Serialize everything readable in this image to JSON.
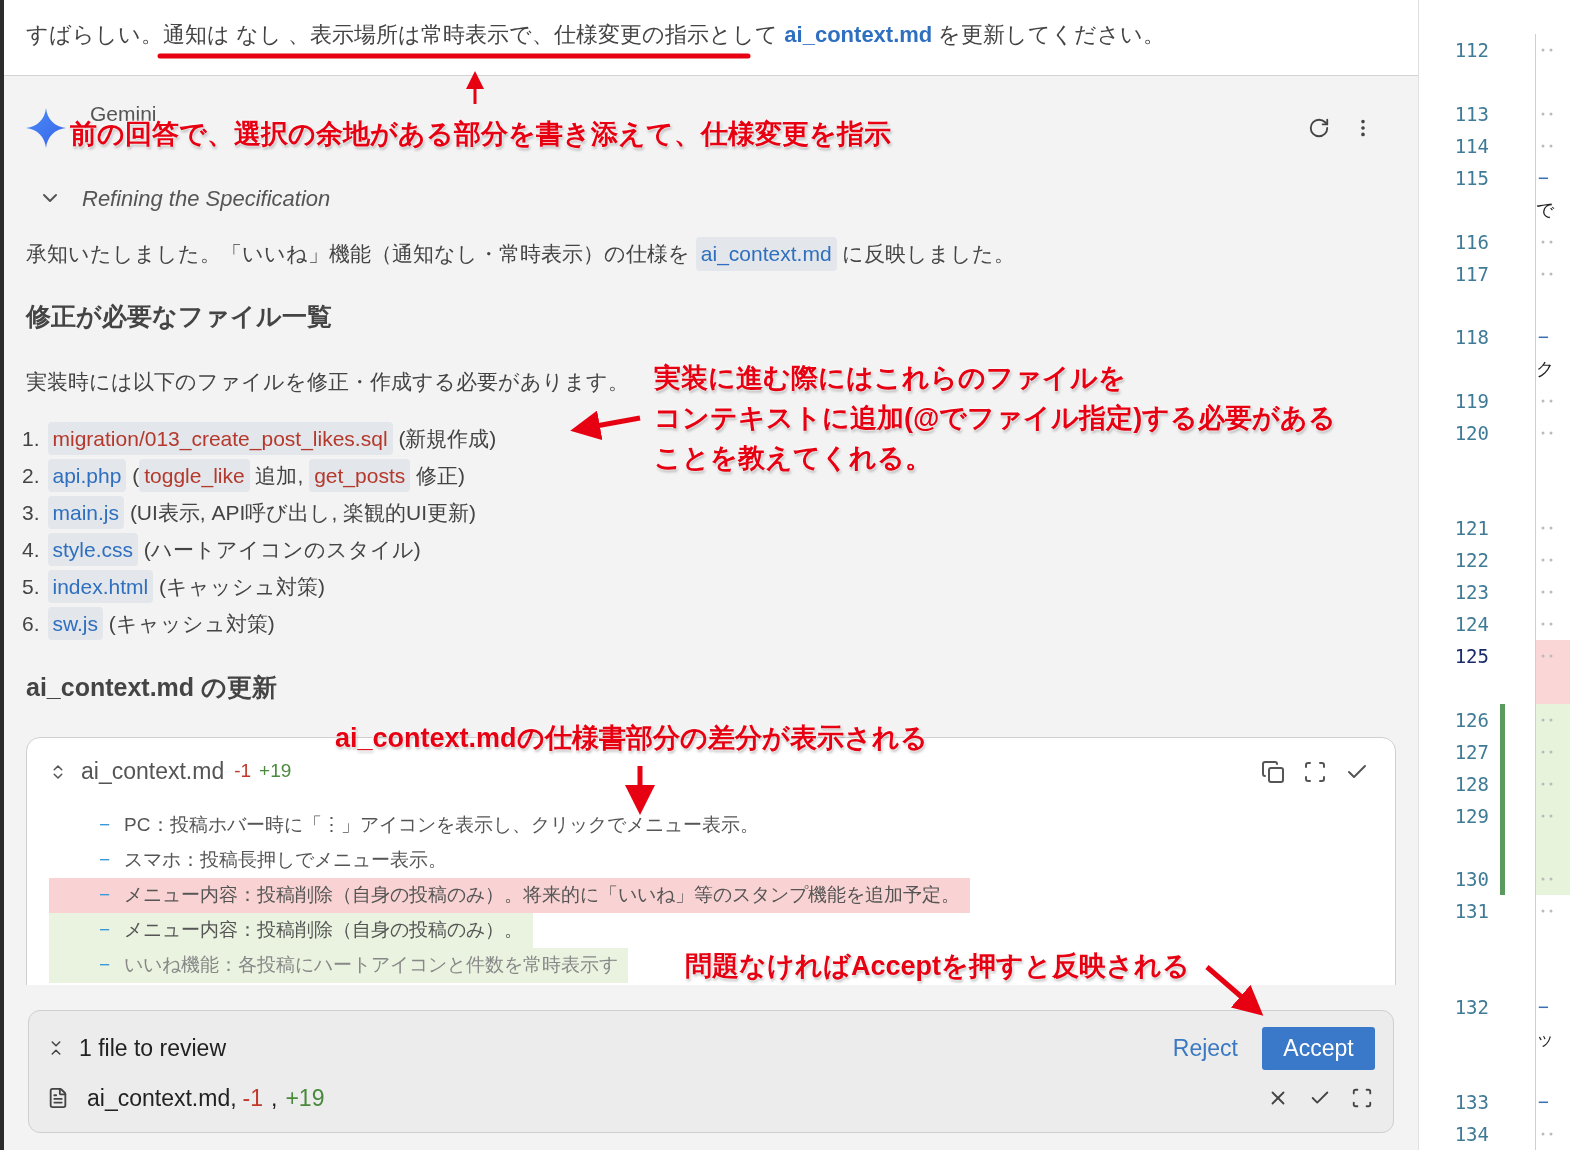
{
  "prompt": {
    "text": "すばらしい。通知は なし 、表示場所は常時表示で、仕様変更の指示として",
    "file": "ai_context.md",
    "after": "を更新してください。"
  },
  "assistant": {
    "name": "Gemini"
  },
  "thought": {
    "title": "Refining the Specification"
  },
  "intro": [
    {
      "text": "承知いたしました。「いいね」機能（通知なし・常時表示）の仕様を "
    },
    {
      "code": "ai_context.md",
      "color": "#2f6fbf"
    },
    {
      "text": " に反映しました。"
    }
  ],
  "files_heading": "修正が必要なファイル一覧",
  "files_lead": "実装時には以下のファイルを修正・作成する必要があります。",
  "files": [
    {
      "number": "1.",
      "parts": [
        {
          "code": "migration/013_create_post_likes.sql",
          "color": "#b5382c"
        },
        {
          "text": " (新規作成)"
        }
      ]
    },
    {
      "number": "2.",
      "parts": [
        {
          "code": "api.php",
          "color": "#2f6fbf"
        },
        {
          "text": " ("
        },
        {
          "code": "toggle_like",
          "color": "#b5382c"
        },
        {
          "text": " 追加, "
        },
        {
          "code": "get_posts",
          "color": "#b5382c"
        },
        {
          "text": " 修正)"
        }
      ]
    },
    {
      "number": "3.",
      "parts": [
        {
          "code": "main.js",
          "color": "#2f6fbf"
        },
        {
          "text": " (UI表示, API呼び出し, 楽観的UI更新)"
        }
      ]
    },
    {
      "number": "4.",
      "parts": [
        {
          "code": "style.css",
          "color": "#2f6fbf"
        },
        {
          "text": " (ハートアイコンのスタイル)"
        }
      ]
    },
    {
      "number": "5.",
      "parts": [
        {
          "code": "index.html",
          "color": "#2f6fbf"
        },
        {
          "text": " (キャッシュ対策)"
        }
      ]
    },
    {
      "number": "6.",
      "parts": [
        {
          "code": "sw.js",
          "color": "#2f6fbf"
        },
        {
          "text": " (キャッシュ対策)"
        }
      ]
    }
  ],
  "update_heading": "ai_context.md の更新",
  "diff": {
    "file": "ai_context.md",
    "removed": "-1",
    "added": "+19",
    "lines": [
      {
        "marker": "−",
        "text": "PC：投稿ホバー時に「⋮」アイコンを表示し、クリックでメニュー表示。",
        "removed": false,
        "added": false
      },
      {
        "marker": "−",
        "text": "スマホ：投稿長押しでメニュー表示。",
        "removed": false,
        "added": false
      },
      {
        "marker": "−",
        "text": "メニュー内容：投稿削除（自身の投稿のみ）。将来的に「いいね」等のスタンプ機能を追加予定。",
        "removed": true,
        "added": false
      },
      {
        "marker": "−",
        "text": "メニュー内容：投稿削除（自身の投稿のみ）。",
        "removed": false,
        "added": true
      },
      {
        "marker": "−",
        "text": "いいね機能：各投稿にハートアイコンと件数を常時表示す",
        "removed": false,
        "added": true
      }
    ]
  },
  "review": {
    "title": "1 file to review",
    "reject": "Reject",
    "accept": "Accept",
    "file": "ai_context.md,",
    "removed": "-1",
    "sep": ",",
    "added": "+19"
  },
  "editor": {
    "lines": [
      {
        "number": "112",
        "removed": false,
        "added": false,
        "current": false
      },
      {
        "number": "113",
        "removed": false,
        "added": false,
        "current": false
      },
      {
        "number": "114",
        "removed": false,
        "added": false,
        "current": false
      },
      {
        "number": "115",
        "removed": false,
        "added": false,
        "current": false,
        "prefix": "−",
        "wrap": "で"
      },
      {
        "number": "116",
        "removed": false,
        "added": false,
        "current": false
      },
      {
        "number": "117",
        "removed": false,
        "added": false,
        "current": false
      },
      {
        "number": "118",
        "removed": false,
        "added": false,
        "current": false,
        "prefix": "−",
        "wrap": "ク"
      },
      {
        "number": "119",
        "removed": false,
        "added": false,
        "current": false
      },
      {
        "number": "120",
        "removed": false,
        "added": false,
        "current": false
      },
      {
        "number": "121",
        "removed": false,
        "added": false,
        "current": false
      },
      {
        "number": "122",
        "removed": false,
        "added": false,
        "current": false
      },
      {
        "number": "123",
        "removed": false,
        "added": false,
        "current": false
      },
      {
        "number": "124",
        "removed": false,
        "added": false,
        "current": false
      },
      {
        "number": "125",
        "removed": true,
        "added": false,
        "current": true
      },
      {
        "number": "126",
        "removed": false,
        "added": true,
        "current": false
      },
      {
        "number": "127",
        "removed": false,
        "added": true,
        "current": false
      },
      {
        "number": "128",
        "removed": false,
        "added": true,
        "current": false
      },
      {
        "number": "129",
        "removed": false,
        "added": true,
        "current": false
      },
      {
        "number": "130",
        "removed": false,
        "added": true,
        "current": false
      },
      {
        "number": "131",
        "removed": false,
        "added": false,
        "current": false
      },
      {
        "number": "132",
        "removed": false,
        "added": false,
        "current": false,
        "prefix": "−",
        "wrap": "ッ"
      },
      {
        "number": "133",
        "removed": false,
        "added": false,
        "current": false,
        "prefix": "−"
      },
      {
        "number": "134",
        "removed": false,
        "added": false,
        "current": false
      }
    ]
  },
  "annotations": [
    {
      "lines": [
        "前の回答で、選択の余地がある部分を書き添えて、仕様変更を指示"
      ]
    },
    {
      "lines": [
        "実装に進む際にはこれらのファイルを",
        "コンテキストに追加(@でファイル指定)する必要がある",
        "ことを教えてくれる。"
      ]
    },
    {
      "lines": [
        "ai_context.mdの仕様書部分の差分が表示される"
      ]
    },
    {
      "lines": [
        "問題なければAcceptを押すと反映される"
      ]
    }
  ]
}
